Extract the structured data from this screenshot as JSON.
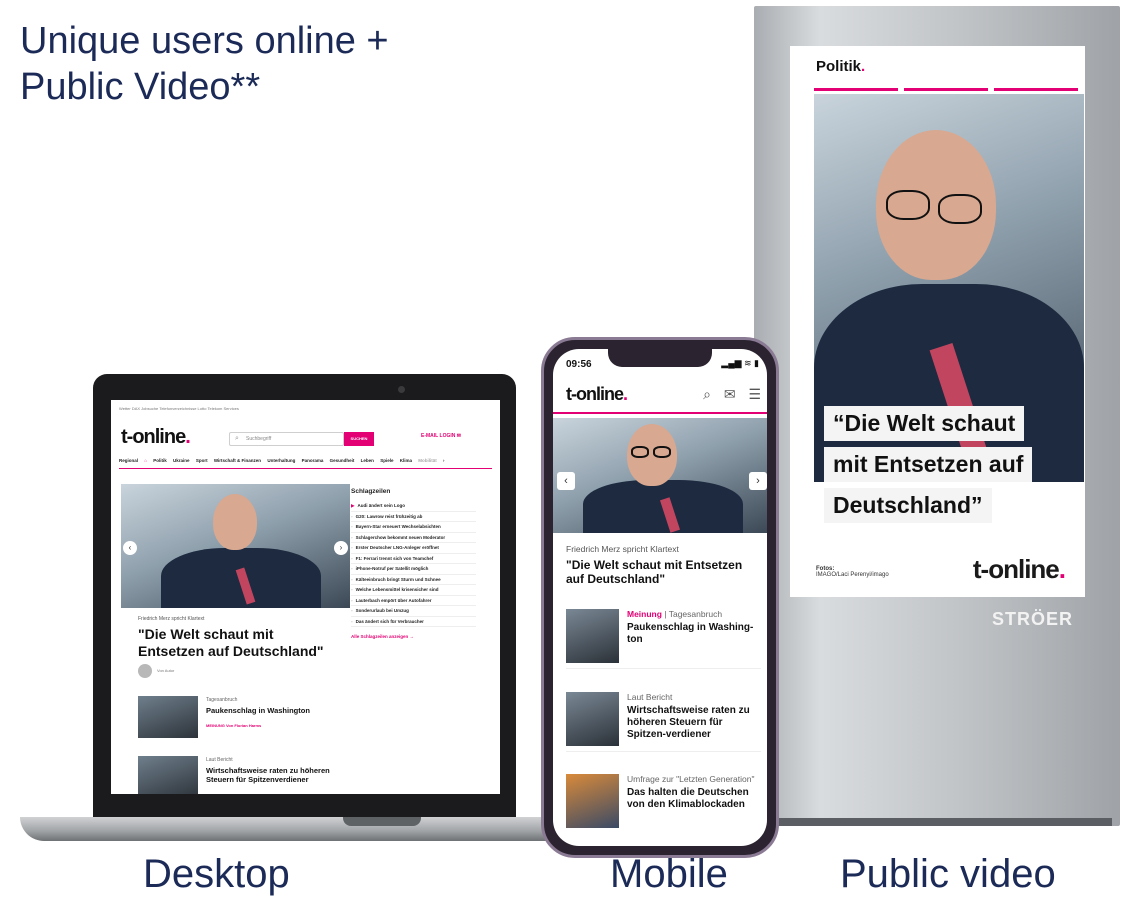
{
  "headline": {
    "line1": "Unique users online +",
    "line2": "Public Video**"
  },
  "captions": {
    "desktop": "Desktop",
    "mobile": "Mobile",
    "public_video": "Public video"
  },
  "public_video": {
    "kicker": "Politik",
    "kicker_dot": ".",
    "quote_lines": [
      "“Die Welt schaut",
      "mit Entsetzen auf",
      "Deutschland”"
    ],
    "credit_label": "Fotos:",
    "credit_text": "IMAGO/Laci Perenyi/imago",
    "logo": "t-online",
    "logo_dot": ".",
    "brand": "STRÖER"
  },
  "desktop": {
    "topbar": "Wetter   DAX   Jobsuche   Telefonverzeichnisse   Lotto   Telekom Services",
    "logo": "t-online",
    "logo_dot": ".",
    "search_placeholder": "Suchbegriff",
    "search_button": "SUCHEN",
    "login": "E-MAIL LOGIN ✉",
    "nav": [
      "Regional",
      "⌂",
      "Politik",
      "Ukraine",
      "Sport",
      "Wirtschaft & Finanzen",
      "Unterhaltung",
      "Panorama",
      "Gesundheit",
      "Leben",
      "Spiele",
      "Klima",
      "Mobilität",
      "›"
    ],
    "hero_kicker": "Friedrich Merz spricht Klartext",
    "hero_title": "\"Die Welt schaut mit Entsetzen auf Deutschland\"",
    "hero_author": "Von Autor",
    "teasers": [
      {
        "kicker": "Tagesanbruch",
        "title": "Paukenschlag in Washington",
        "meta": "MEINUNG   Von Florian Harms"
      },
      {
        "kicker": "Laut Bericht",
        "title": "Wirtschaftsweise raten zu höheren Steuern für Spitzenverdiener",
        "meta": ""
      }
    ],
    "sidebar": {
      "heading": "Schlagzeilen",
      "items": [
        "Audi ändert sein Logo",
        "G20: Lawrow reist frühzeitig ab",
        "Bayern-Star erneuert Wechselabsichten",
        "Schlagerchow bekommt neuen Moderator",
        "Erster Deutscher LNG-Anleger eröffnet",
        "F1: Ferrari trennt sich von Teamchef",
        "iPhone-Notruf per Satellit möglich",
        "Kälteeinbruch bringt Sturm und Schnee",
        "Welche Lebensmittel krisensicher sind",
        "Lauterbach empört über Autofahrer",
        "Sonderurlaub bei Umzug",
        "Das ändert sich für Verbraucher"
      ],
      "more": "Alle Schlagzeilen anzeigen →"
    }
  },
  "mobile": {
    "time": "09:56",
    "status": "▂▄▆ ≋ ▮",
    "logo": "t-online",
    "logo_dot": ".",
    "icons": {
      "search": "⌕",
      "mail": "✉",
      "menu": "☰"
    },
    "hero_kicker": "Friedrich Merz spricht Klartext",
    "hero_title": "\"Die Welt schaut mit Entsetzen auf Deutschland\"",
    "teasers": [
      {
        "tag": "Meinung",
        "kicker": " | Tagesanbruch",
        "title": "Paukenschlag in Washing-ton"
      },
      {
        "tag": "",
        "kicker": "Laut Bericht",
        "title": "Wirtschaftsweise raten zu höheren Steuern für Spitzen-verdiener"
      },
      {
        "tag": "",
        "kicker": "Umfrage zur \"Letzten Generation\"",
        "title": "Das halten die Deutschen von den Klimablockaden"
      }
    ]
  }
}
